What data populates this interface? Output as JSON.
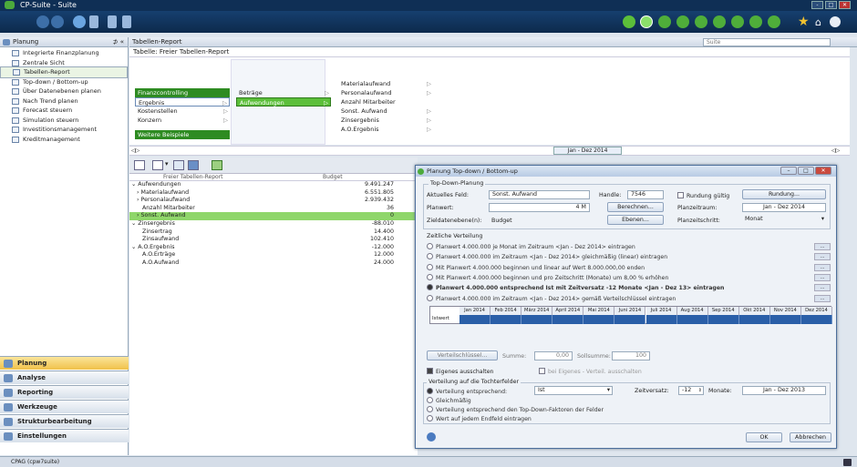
{
  "app": {
    "title": "CP-Suite - Suite",
    "logo_icon": "cp-suite-logo-icon"
  },
  "window_buttons": [
    "-",
    "□",
    "✕"
  ],
  "colors": {
    "accent_green": "#2e8b22",
    "selection_green": "#8fd66a",
    "navy": "#0f2f55"
  },
  "left_panel": {
    "header": "Planung",
    "pin": "⊅ «",
    "items": [
      {
        "label": "Integrierte Finanzplanung",
        "icon": "finance-icon"
      },
      {
        "label": "Zentrale Sicht",
        "icon": "tree-icon"
      },
      {
        "label": "Tabellen-Report",
        "icon": "table-icon"
      },
      {
        "label": "Top-down / Bottom-up",
        "icon": "top-down-icon"
      },
      {
        "label": "Über Datenebenen planen",
        "icon": "layers-icon"
      },
      {
        "label": "Nach Trend planen",
        "icon": "trend-icon"
      },
      {
        "label": "Forecast steuern",
        "icon": "forecast-icon"
      },
      {
        "label": "Simulation steuern",
        "icon": "simulation-icon"
      },
      {
        "label": "Investitionsmanagement",
        "icon": "investment-icon"
      },
      {
        "label": "Kreditmanagement",
        "icon": "credit-icon"
      }
    ],
    "sections": [
      "Planung",
      "Analyse",
      "Reporting",
      "Werkzeuge",
      "Strukturbearbeitung",
      "Einstellungen"
    ]
  },
  "main": {
    "header": "Tabellen-Report",
    "search_placeholder": "Suite",
    "subheader": "Tabelle: Freier Tabellen-Report",
    "menu": {
      "col1": [
        "Finanzcontrolling",
        "Ergebnis",
        "Kostenstellen",
        "Konzern"
      ],
      "col1_extra": "Weitere Beispiele",
      "col2": [
        "Beträge",
        "Aufwendungen"
      ],
      "col3": [
        "Materialaufwand",
        "Personalaufwand",
        "Anzahl Mitarbeiter",
        "Sonst. Aufwand",
        "Zinsergebnis",
        "A.O.Ergebnis"
      ]
    },
    "date_range": "Jan - Dez 2014"
  },
  "grid": {
    "col_name": "Freier Tabellen-Report",
    "col_value": "Budget",
    "rows": [
      {
        "name": "Aufwendungen",
        "value": "9.491.247",
        "indent": 0,
        "prefix": "⌄"
      },
      {
        "name": "Materialaufwand",
        "value": "6.551.805",
        "indent": 1,
        "prefix": "›"
      },
      {
        "name": "Personalaufwand",
        "value": "2.939.432",
        "indent": 1,
        "prefix": "›"
      },
      {
        "name": "Anzahl Mitarbeiter",
        "value": "36",
        "indent": 2,
        "prefix": ""
      },
      {
        "name": "Sonst. Aufwand",
        "value": "0",
        "indent": 1,
        "prefix": "›",
        "selected": true
      },
      {
        "name": "Zinsergebnis",
        "value": "-88.010",
        "indent": 0,
        "prefix": "⌄"
      },
      {
        "name": "Zinsertrag",
        "value": "14.400",
        "indent": 2,
        "prefix": ""
      },
      {
        "name": "Zinsaufwand",
        "value": "102.410",
        "indent": 2,
        "prefix": ""
      },
      {
        "name": "A.O.Ergebnis",
        "value": "-12.000",
        "indent": 0,
        "prefix": "⌄"
      },
      {
        "name": "A.O.Erträge",
        "value": "12.000",
        "indent": 2,
        "prefix": ""
      },
      {
        "name": "A.O.Aufwand",
        "value": "24.000",
        "indent": 2,
        "prefix": ""
      }
    ]
  },
  "dialog": {
    "title": "Planung Top-down / Bottom-up",
    "group1": "Top-Down-Planung",
    "aktuelles_feld_label": "Aktuelles Feld:",
    "aktuelles_feld_value": "Sonst. Aufwand",
    "handle_label": "Handle:",
    "handle_value": "7546",
    "rundung_label": "Rundung gültig",
    "rundung_button": "Rundung...",
    "planwert_label": "Planwert:",
    "planwert_value": "4 M",
    "berechnen_button": "Berechnen...",
    "planzeitraum_label": "Planzeitraum:",
    "planzeitraum_value": "Jan - Dez 2014",
    "zieldatenebene_label": "Zieldatenebene(n):",
    "zieldatenebene_value": "Budget",
    "ebenen_button": "Ebenen...",
    "planzeitschritt_label": "Planzeitschritt:",
    "planzeitschritt_value": "Monat",
    "group2": "Zeitliche Verteilung",
    "options": [
      "Planwert 4.000.000 je Monat im Zeitraum <Jan - Dez 2014> eintragen",
      "Planwert 4.000.000 im Zeitraum <Jan - Dez 2014> gleichmäßig (linear) eintragen",
      "Mit Planwert 4.000.000 beginnen und linear auf Wert 8.000.000,00 enden",
      "Mit Planwert 4.000.000 beginnen und pro Zeitschritt (Monate) um 8,00 % erhöhen",
      "Planwert 4.000.000 entsprechend Ist mit Zeitversatz -12 Monate <Jan - Dez 13> eintragen",
      "Planwert 4.000.000 im Zeitraum <Jan - Dez 2014> gemäß Verteilschlüssel eintragen"
    ],
    "selected_option": 4,
    "months": [
      "Jan 2014",
      "Feb 2014",
      "März 2014",
      "April 2014",
      "Mai 2014",
      "Juni 2014",
      "Juli 2014",
      "Aug 2014",
      "Sep 2014",
      "Okt 2014",
      "Nov 2014",
      "Dez 2014"
    ],
    "row_label": "Istwert",
    "verteilschluessel_button": "Verteilschlüssel...",
    "summe_label": "Summe:",
    "summe_value": "0,00",
    "sollsumme_label": "Sollsumme:",
    "sollsumme_value": "100",
    "chk_eigenes": "Eigenes ausschalten",
    "chk_bei": "bei Eigenes - Verteil. ausschalten",
    "group3": "Verteilung auf die Tochterfelder",
    "verteilung_label": "Verteilung entsprechend:",
    "verteilung_value": "Ist",
    "zeitversatz_label": "Zeitversatz:",
    "zeitversatz_value": "-12",
    "monate_label": "Monate:",
    "monate_value": "Jan - Dez 2013",
    "radio_gleich": "Gleichmäßig",
    "radio_topdown": "Verteilung entsprechend den Top-Down-Faktoren der Felder",
    "radio_wert": "Wert auf jedem Endfeld eintragen",
    "ok_button": "OK",
    "cancel_button": "Abbrechen"
  },
  "status": "CPAG (cpw7suite)"
}
